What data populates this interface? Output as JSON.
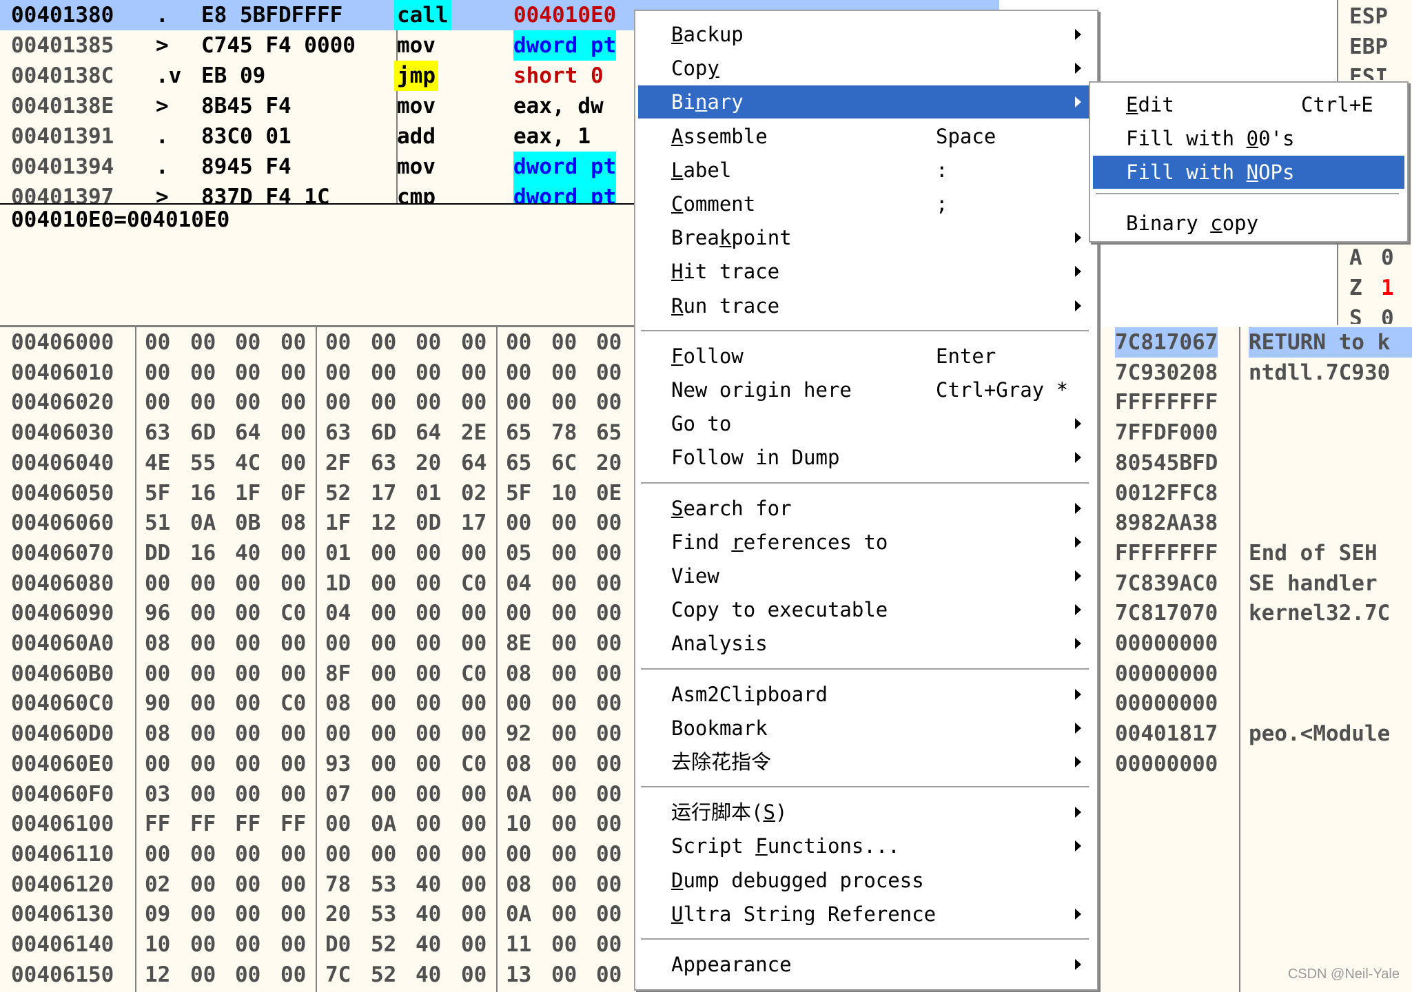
{
  "disasm": {
    "rows": [
      {
        "addr": "00401380",
        "marker": ".",
        "hex": "E8 5BFDFFFF",
        "mnem": "call",
        "op": "004010E0",
        "selected": true
      },
      {
        "addr": "00401385",
        "marker": ">",
        "hex": "C745 F4 0000",
        "mnem": "mov",
        "op": "dword pt"
      },
      {
        "addr": "0040138C",
        "marker": ".v",
        "hex": "EB 09",
        "mnem": "jmp",
        "op": "short 0"
      },
      {
        "addr": "0040138E",
        "marker": ">",
        "hex": "8B45 F4",
        "mnem": "mov",
        "op": "eax, dw"
      },
      {
        "addr": "00401391",
        "marker": ".",
        "hex": "83C0 01",
        "mnem": "add",
        "op": "eax, 1"
      },
      {
        "addr": "00401394",
        "marker": ".",
        "hex": "8945 F4",
        "mnem": "mov",
        "op": "dword pt"
      },
      {
        "addr": "00401397",
        "marker": ">",
        "hex": "837D F4 1C",
        "mnem": "cmp",
        "op": "dword pt"
      }
    ]
  },
  "info": {
    "text": "004010E0=004010E0"
  },
  "registers": {
    "esp": "ESP",
    "ebp": "EBP",
    "esi": "ESI",
    "flag_a": "A",
    "flag_a_val": "0",
    "flag_z": "Z",
    "flag_z_val": "1",
    "flag_s": "S",
    "flag_s_val": "0"
  },
  "dump": {
    "rows": [
      {
        "addr": "00406000",
        "bytes": [
          "00",
          "00",
          "00",
          "00",
          "00",
          "00",
          "00",
          "00",
          "00",
          "00",
          "00"
        ]
      },
      {
        "addr": "00406010",
        "bytes": [
          "00",
          "00",
          "00",
          "00",
          "00",
          "00",
          "00",
          "00",
          "00",
          "00",
          "00"
        ]
      },
      {
        "addr": "00406020",
        "bytes": [
          "00",
          "00",
          "00",
          "00",
          "00",
          "00",
          "00",
          "00",
          "00",
          "00",
          "00"
        ]
      },
      {
        "addr": "00406030",
        "bytes": [
          "63",
          "6D",
          "64",
          "00",
          "63",
          "6D",
          "64",
          "2E",
          "65",
          "78",
          "65"
        ]
      },
      {
        "addr": "00406040",
        "bytes": [
          "4E",
          "55",
          "4C",
          "00",
          "2F",
          "63",
          "20",
          "64",
          "65",
          "6C",
          "20"
        ]
      },
      {
        "addr": "00406050",
        "bytes": [
          "5F",
          "16",
          "1F",
          "0F",
          "52",
          "17",
          "01",
          "02",
          "5F",
          "10",
          "0E"
        ]
      },
      {
        "addr": "00406060",
        "bytes": [
          "51",
          "0A",
          "0B",
          "08",
          "1F",
          "12",
          "0D",
          "17",
          "00",
          "00",
          "00"
        ]
      },
      {
        "addr": "00406070",
        "bytes": [
          "DD",
          "16",
          "40",
          "00",
          "01",
          "00",
          "00",
          "00",
          "05",
          "00",
          "00"
        ]
      },
      {
        "addr": "00406080",
        "bytes": [
          "00",
          "00",
          "00",
          "00",
          "1D",
          "00",
          "00",
          "C0",
          "04",
          "00",
          "00"
        ]
      },
      {
        "addr": "00406090",
        "bytes": [
          "96",
          "00",
          "00",
          "C0",
          "04",
          "00",
          "00",
          "00",
          "00",
          "00",
          "00"
        ]
      },
      {
        "addr": "004060A0",
        "bytes": [
          "08",
          "00",
          "00",
          "00",
          "00",
          "00",
          "00",
          "00",
          "8E",
          "00",
          "00"
        ]
      },
      {
        "addr": "004060B0",
        "bytes": [
          "00",
          "00",
          "00",
          "00",
          "8F",
          "00",
          "00",
          "C0",
          "08",
          "00",
          "00"
        ]
      },
      {
        "addr": "004060C0",
        "bytes": [
          "90",
          "00",
          "00",
          "C0",
          "08",
          "00",
          "00",
          "00",
          "00",
          "00",
          "00"
        ]
      },
      {
        "addr": "004060D0",
        "bytes": [
          "08",
          "00",
          "00",
          "00",
          "00",
          "00",
          "00",
          "00",
          "92",
          "00",
          "00"
        ]
      },
      {
        "addr": "004060E0",
        "bytes": [
          "00",
          "00",
          "00",
          "00",
          "93",
          "00",
          "00",
          "C0",
          "08",
          "00",
          "00"
        ]
      },
      {
        "addr": "004060F0",
        "bytes": [
          "03",
          "00",
          "00",
          "00",
          "07",
          "00",
          "00",
          "00",
          "0A",
          "00",
          "00"
        ]
      },
      {
        "addr": "00406100",
        "bytes": [
          "FF",
          "FF",
          "FF",
          "FF",
          "00",
          "0A",
          "00",
          "00",
          "10",
          "00",
          "00"
        ]
      },
      {
        "addr": "00406110",
        "bytes": [
          "00",
          "00",
          "00",
          "00",
          "00",
          "00",
          "00",
          "00",
          "00",
          "00",
          "00"
        ]
      },
      {
        "addr": "00406120",
        "bytes": [
          "02",
          "00",
          "00",
          "00",
          "78",
          "53",
          "40",
          "00",
          "08",
          "00",
          "00"
        ]
      },
      {
        "addr": "00406130",
        "bytes": [
          "09",
          "00",
          "00",
          "00",
          "20",
          "53",
          "40",
          "00",
          "0A",
          "00",
          "00"
        ]
      },
      {
        "addr": "00406140",
        "bytes": [
          "10",
          "00",
          "00",
          "00",
          "D0",
          "52",
          "40",
          "00",
          "11",
          "00",
          "00"
        ]
      },
      {
        "addr": "00406150",
        "bytes": [
          "12",
          "00",
          "00",
          "00",
          "7C",
          "52",
          "40",
          "00",
          "13",
          "00",
          "00"
        ]
      }
    ]
  },
  "stack": {
    "rows": [
      {
        "val": "7C817067",
        "comment": "RETURN to k",
        "selected": true
      },
      {
        "val": "7C930208",
        "comment": "ntdll.7C930"
      },
      {
        "val": "FFFFFFFF",
        "comment": ""
      },
      {
        "val": "7FFDF000",
        "comment": ""
      },
      {
        "val": "80545BFD",
        "comment": ""
      },
      {
        "val": "0012FFC8",
        "comment": ""
      },
      {
        "val": "8982AA38",
        "comment": ""
      },
      {
        "val": "FFFFFFFF",
        "comment": "End of SEH"
      },
      {
        "val": "7C839AC0",
        "comment": "SE handler"
      },
      {
        "val": "7C817070",
        "comment": "kernel32.7C"
      },
      {
        "val": "00000000",
        "comment": ""
      },
      {
        "val": "00000000",
        "comment": ""
      },
      {
        "val": "00000000",
        "comment": ""
      },
      {
        "val": "00401817",
        "comment": "peo.<Module"
      },
      {
        "val": "00000000",
        "comment": ""
      }
    ]
  },
  "menu": {
    "items": [
      {
        "pre": "",
        "u": "B",
        "post": "ackup",
        "shortcut": "",
        "sub": true
      },
      {
        "pre": "Cop",
        "u": "y",
        "post": "",
        "shortcut": "",
        "sub": true
      },
      {
        "pre": "Bi",
        "u": "n",
        "post": "ary",
        "shortcut": "",
        "sub": true,
        "selected": true
      },
      {
        "pre": "",
        "u": "A",
        "post": "ssemble",
        "shortcut": "Space",
        "sub": false
      },
      {
        "pre": "",
        "u": "L",
        "post": "abel",
        "shortcut": ":",
        "sub": false
      },
      {
        "pre": "",
        "u": "C",
        "post": "omment",
        "shortcut": ";",
        "sub": false
      },
      {
        "pre": "Brea",
        "u": "k",
        "post": "point",
        "shortcut": "",
        "sub": true
      },
      {
        "pre": "",
        "u": "H",
        "post": "it trace",
        "shortcut": "",
        "sub": true
      },
      {
        "pre": "",
        "u": "R",
        "post": "un trace",
        "shortcut": "",
        "sub": true
      },
      {
        "pre": "",
        "u": "F",
        "post": "ollow",
        "shortcut": "Enter",
        "sub": false
      },
      {
        "pre": "New origin here",
        "u": "",
        "post": "",
        "shortcut": "Ctrl+Gray *",
        "sub": false
      },
      {
        "pre": "Go to",
        "u": "",
        "post": "",
        "shortcut": "",
        "sub": true
      },
      {
        "pre": "Follow in Dump",
        "u": "",
        "post": "",
        "shortcut": "",
        "sub": true
      },
      {
        "pre": "",
        "u": "S",
        "post": "earch for",
        "shortcut": "",
        "sub": true
      },
      {
        "pre": "Find ",
        "u": "r",
        "post": "eferences to",
        "shortcut": "",
        "sub": true
      },
      {
        "pre": "View",
        "u": "",
        "post": "",
        "shortcut": "",
        "sub": true
      },
      {
        "pre": "Copy to executable",
        "u": "",
        "post": "",
        "shortcut": "",
        "sub": true
      },
      {
        "pre": "Analysis",
        "u": "",
        "post": "",
        "shortcut": "",
        "sub": true
      },
      {
        "pre": "Asm2Clipboard",
        "u": "",
        "post": "",
        "shortcut": "",
        "sub": true
      },
      {
        "pre": "Bookmark",
        "u": "",
        "post": "",
        "shortcut": "",
        "sub": true
      },
      {
        "pre": "去除花指令",
        "u": "",
        "post": "",
        "shortcut": "",
        "sub": true
      },
      {
        "pre": "运行脚本(",
        "u": "S",
        "post": ")",
        "shortcut": "",
        "sub": true
      },
      {
        "pre": "Script ",
        "u": "F",
        "post": "unctions...",
        "shortcut": "",
        "sub": true
      },
      {
        "pre": "",
        "u": "D",
        "post": "ump debugged process",
        "shortcut": "",
        "sub": false
      },
      {
        "pre": "",
        "u": "U",
        "post": "ltra String Reference",
        "shortcut": "",
        "sub": true
      },
      {
        "pre": "Appearance",
        "u": "",
        "post": "",
        "shortcut": "",
        "sub": true
      }
    ]
  },
  "submenu": {
    "items": [
      {
        "pre": "",
        "u": "E",
        "post": "dit",
        "shortcut": "Ctrl+E"
      },
      {
        "pre": "Fill with ",
        "u": "0",
        "post": "0's",
        "shortcut": ""
      },
      {
        "pre": "Fill with ",
        "u": "N",
        "post": "OPs",
        "shortcut": "",
        "selected": true
      },
      {
        "pre": "Binary ",
        "u": "c",
        "post": "opy",
        "shortcut": ""
      }
    ]
  },
  "watermark": "CSDN @Neil-Yale"
}
